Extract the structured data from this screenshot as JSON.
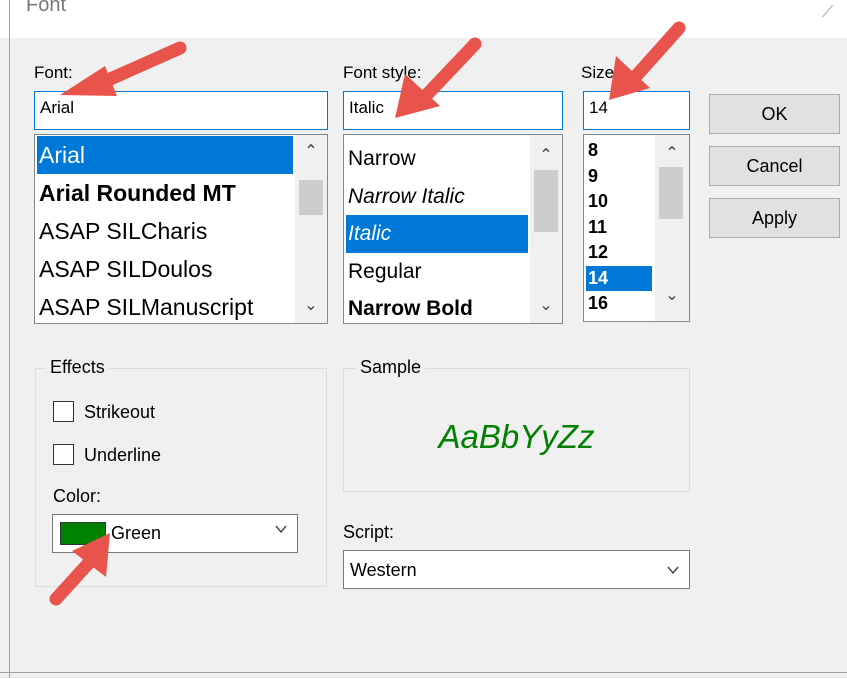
{
  "dialog": {
    "title": "Font"
  },
  "font": {
    "label": "Font:",
    "value": "Arial",
    "items": [
      {
        "name": "Arial",
        "selected": true
      },
      {
        "name": "Arial Rounded MT",
        "bold": true
      },
      {
        "name": "ASAP SILCharis"
      },
      {
        "name": "ASAP SILDoulos"
      },
      {
        "name": "ASAP SILManuscript"
      }
    ]
  },
  "font_style": {
    "label": "Font style:",
    "value": "Italic",
    "items": [
      {
        "name": "Narrow"
      },
      {
        "name": "Narrow Italic",
        "italic": true
      },
      {
        "name": "Italic",
        "italic": true,
        "selected": true
      },
      {
        "name": "Regular"
      },
      {
        "name": "Narrow Bold",
        "bold": true
      }
    ]
  },
  "size": {
    "label": "Size:",
    "value": "14",
    "items": [
      "8",
      "9",
      "10",
      "11",
      "12",
      "14",
      "16"
    ],
    "selected": "14"
  },
  "buttons": {
    "ok": "OK",
    "cancel": "Cancel",
    "apply": "Apply"
  },
  "effects": {
    "legend": "Effects",
    "strikeout": {
      "label": "Strikeout",
      "checked": false
    },
    "underline": {
      "label": "Underline",
      "checked": false
    },
    "color_label": "Color:",
    "color_value": "Green",
    "color_hex": "#008000"
  },
  "sample": {
    "legend": "Sample",
    "text": "AaBbYyZz"
  },
  "script": {
    "label": "Script:",
    "value": "Western"
  },
  "colors": {
    "selection": "#0078d7",
    "annotation_arrow": "#e8544c"
  }
}
